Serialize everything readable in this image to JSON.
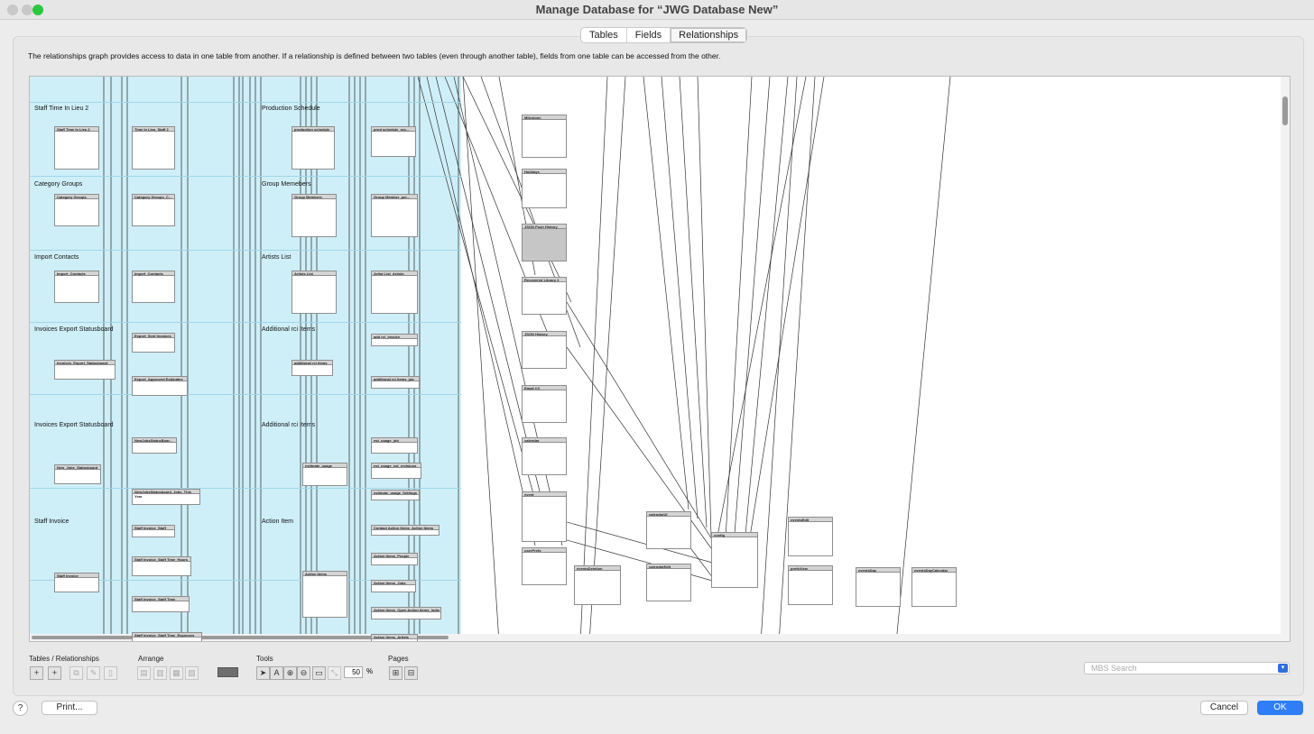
{
  "window": {
    "title": "Manage Database for “JWG Database New”"
  },
  "tabs": [
    "Tables",
    "Fields",
    "Relationships"
  ],
  "active_tab": "Relationships",
  "description": "The relationships graph provides access to data in one table from another. If a relationship is defined between two tables (even through another table), fields from one table can be accessed from the other.",
  "graph": {
    "groups": [
      "Staff Time In Lieu 2",
      "Category Groups",
      "Import Contacts",
      "Invoices Export Statusboard",
      "Invoices Export Statusboard",
      "Staff Invoice",
      "Production Schedule",
      "Group Memebers",
      "Artists List",
      "Additional rci Items",
      "Additional rci Items",
      "Action Item"
    ],
    "tables": [
      "Staff Time In Lieu 2",
      "Time In Lieu_Staff 2",
      "Category Groups",
      "Category Groups_C...",
      "Import_Contacts",
      "Import_Contacts",
      "Invoices_Export_Statusboard",
      "Export_Sent Invoices",
      "Export_Approved Estimates",
      "New_Jobs_Statusboard",
      "NewJobsStatusBoar...",
      "NewJobsStatusboard_Jobs_This Year",
      "Staff Invoice",
      "Staff Invoice_Staff",
      "Staff Invoice_Staff Time_Hours",
      "Staff Invoice_Staff Time",
      "Staff Invoice_Staff Time_Expenses",
      "production schedule",
      "prod schedule_scc...",
      "Group Members",
      "Group Member_per...",
      "Artists List",
      "Artist List_Artists",
      "additional rci items",
      "add rci_invoice",
      "additional rci items_job",
      "estimate_usage",
      "est_usage_job",
      "est_usage_est_revisions",
      "estimate_usage_Settings",
      "Action Items",
      "Contact Action Items_Action Items",
      "Action Items_People",
      "Action Items_Jobs",
      "Action Items_Open Action Items_Indiv",
      "Action Items_Artists",
      "Milestone",
      "Holidays",
      "JSON Push History",
      "Recovered Library 2",
      "JSON History",
      "Email CC",
      "calendar",
      "event",
      "userPrefs",
      "eventsDeletion",
      "calendarUI",
      "calendarEdit",
      "config",
      "eventsEdit",
      "prefsView",
      "eventsDay",
      "eventsDayCalendar"
    ]
  },
  "toolbar": {
    "tables_relationships": "Tables / Relationships",
    "arrange": "Arrange",
    "tools": "Tools",
    "pages": "Pages",
    "zoom": "50",
    "zoom_unit": "%",
    "search_placeholder": "MBS Search"
  },
  "buttons": {
    "help": "?",
    "print": "Print...",
    "cancel": "Cancel",
    "ok": "OK"
  },
  "colors": {
    "graph_bg": "#cfeff8",
    "accent": "#2f7ef5"
  }
}
